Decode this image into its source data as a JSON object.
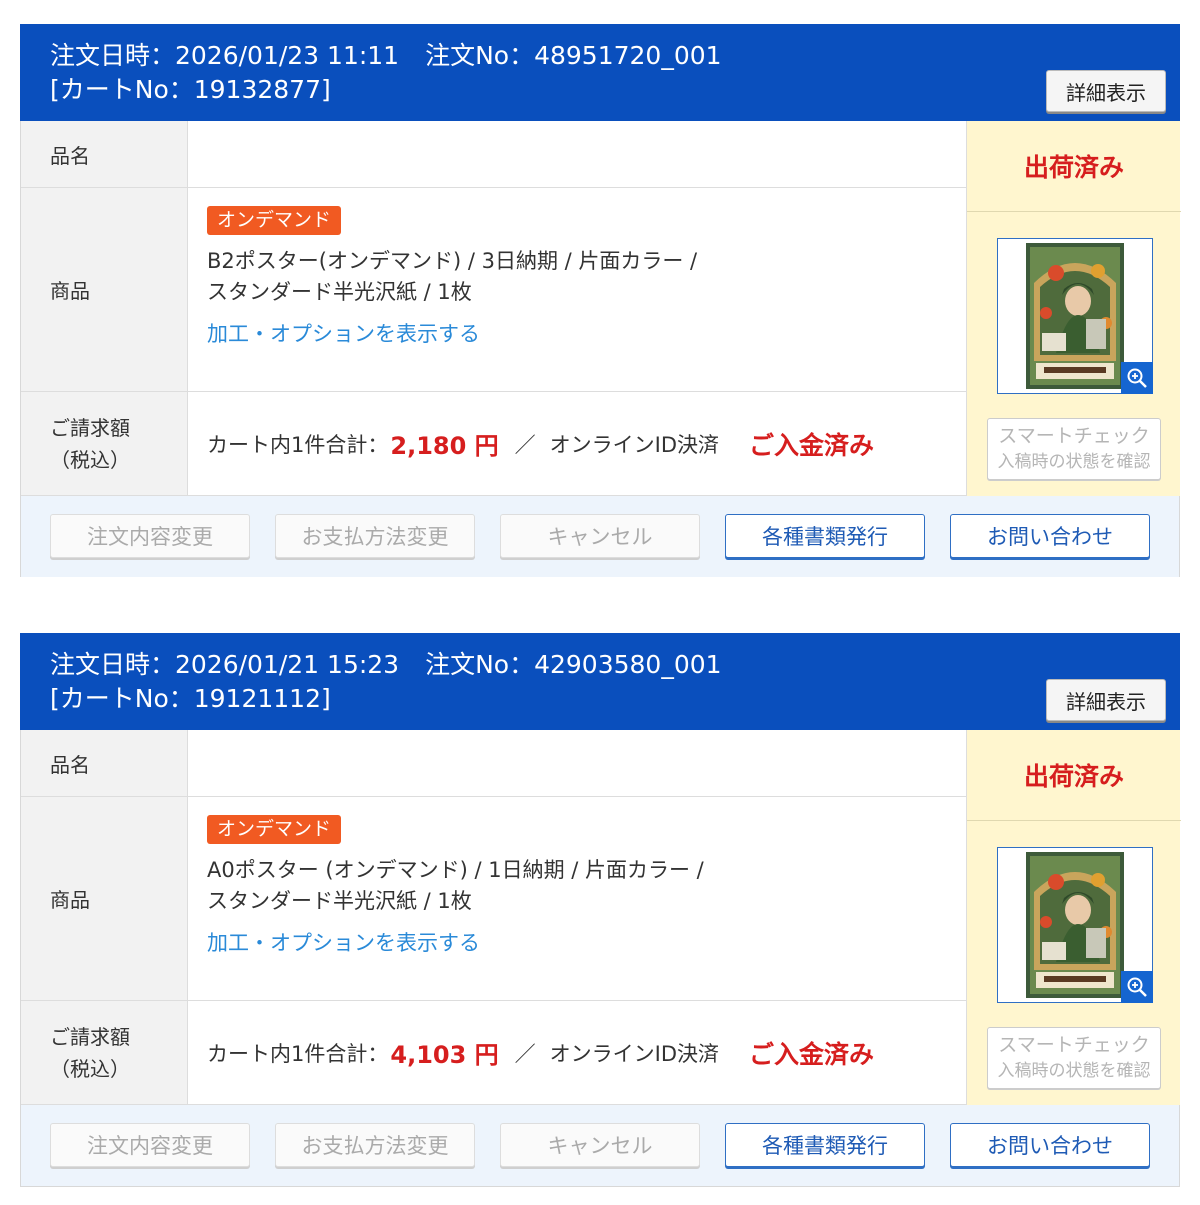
{
  "orders": [
    {
      "header": {
        "date_label": "注文日時：2026/01/23 11:11",
        "order_no_label": "注文No：48951720_001",
        "cart_no_label": "[カートNo：19132877]",
        "detail_button": "詳細表示"
      },
      "labels": {
        "name": "品名",
        "product": "商品",
        "price_line1": "ご請求額",
        "price_line2": "（税込）"
      },
      "product": {
        "badge": "オンデマンド",
        "line1": "B2ポスター(オンデマンド) / 3日納期 / 片面カラー /",
        "line2": "スタンダード半光沢紙 / 1枚",
        "option_link": "加工・オプションを表示する"
      },
      "price": {
        "prefix": "カート内1件合計：",
        "amount": "2,180 円",
        "separator": "／",
        "payment": "オンラインID決済",
        "payment_status": "ご入金済み"
      },
      "shipping_status": "出荷済み",
      "smart_check": {
        "line1": "スマートチェック",
        "line2": "入稿時の状態を確認"
      },
      "actions": [
        "注文内容変更",
        "お支払方法変更",
        "キャンセル",
        "各種書類発行",
        "お問い合わせ"
      ]
    },
    {
      "header": {
        "date_label": "注文日時：2026/01/21 15:23",
        "order_no_label": "注文No：42903580_001",
        "cart_no_label": "[カートNo：19121112]",
        "detail_button": "詳細表示"
      },
      "labels": {
        "name": "品名",
        "product": "商品",
        "price_line1": "ご請求額",
        "price_line2": "（税込）"
      },
      "product": {
        "badge": "オンデマンド",
        "line1": "A0ポスター (オンデマンド) / 1日納期 / 片面カラー /",
        "line2": "スタンダード半光沢紙 / 1枚",
        "option_link": "加工・オプションを表示する"
      },
      "price": {
        "prefix": "カート内1件合計：",
        "amount": "4,103 円",
        "separator": "／",
        "payment": "オンラインID決済",
        "payment_status": "ご入金済み"
      },
      "shipping_status": "出荷済み",
      "smart_check": {
        "line1": "スマートチェック",
        "line2": "入稿時の状態を確認"
      },
      "actions": [
        "注文内容変更",
        "お支払方法変更",
        "キャンセル",
        "各種書類発行",
        "お問い合わせ"
      ]
    }
  ],
  "icons": {
    "zoom": "zoom-in-icon",
    "thumbnail": "poster-thumbnail"
  },
  "colors": {
    "header_bg": "#0a4fbd",
    "status_red": "#d61e1e",
    "badge_orange": "#f15a22",
    "link_blue": "#2a8ad8",
    "status_col_bg": "#fff6cf",
    "action_bar_bg": "#edf4fc"
  }
}
